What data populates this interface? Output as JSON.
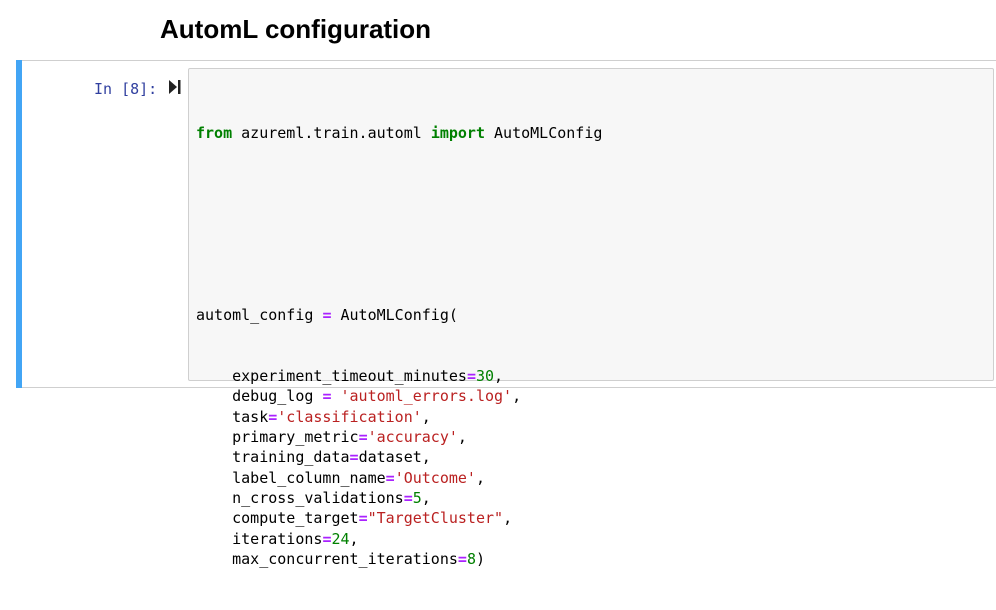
{
  "heading": "AutomL configuration",
  "cell": {
    "prompt": "In [8]:",
    "code": {
      "line1": {
        "kw1": "from",
        "mod": " azureml.train.automl ",
        "kw2": "import",
        "name": " AutoMLConfig"
      },
      "line2": {
        "pre": "automl_config ",
        "op": "=",
        "post": " AutoMLConfig("
      },
      "args": [
        {
          "key": "experiment_timeout_minutes",
          "val": "30",
          "val_type": "num",
          "sep": ","
        },
        {
          "key": "debug_log ",
          "val": " 'automl_errors.log'",
          "val_type": "str",
          "sep": ","
        },
        {
          "key": "task",
          "val": "'classification'",
          "val_type": "str",
          "sep": ","
        },
        {
          "key": "primary_metric",
          "val": "'accuracy'",
          "val_type": "str",
          "sep": ","
        },
        {
          "key": "training_data",
          "val": "dataset",
          "val_type": "plain",
          "sep": ","
        },
        {
          "key": "label_column_name",
          "val": "'Outcome'",
          "val_type": "str",
          "sep": ","
        },
        {
          "key": "n_cross_validations",
          "val": "5",
          "val_type": "num",
          "sep": ","
        },
        {
          "key": "compute_target",
          "val": "\"TargetCluster\"",
          "val_type": "str",
          "sep": ","
        },
        {
          "key": "iterations",
          "val": "24",
          "val_type": "num",
          "sep": ","
        },
        {
          "key": "max_concurrent_iterations",
          "val": "8",
          "val_type": "num",
          "sep": ")"
        }
      ]
    }
  },
  "colors": {
    "cell_bar": "#42a5f5",
    "prompt": "#303f9f",
    "keyword": "#008000",
    "operator": "#aa22ff",
    "string": "#ba2121",
    "code_bg": "#f7f7f7"
  },
  "icons": {
    "run": "run-cell-icon"
  }
}
